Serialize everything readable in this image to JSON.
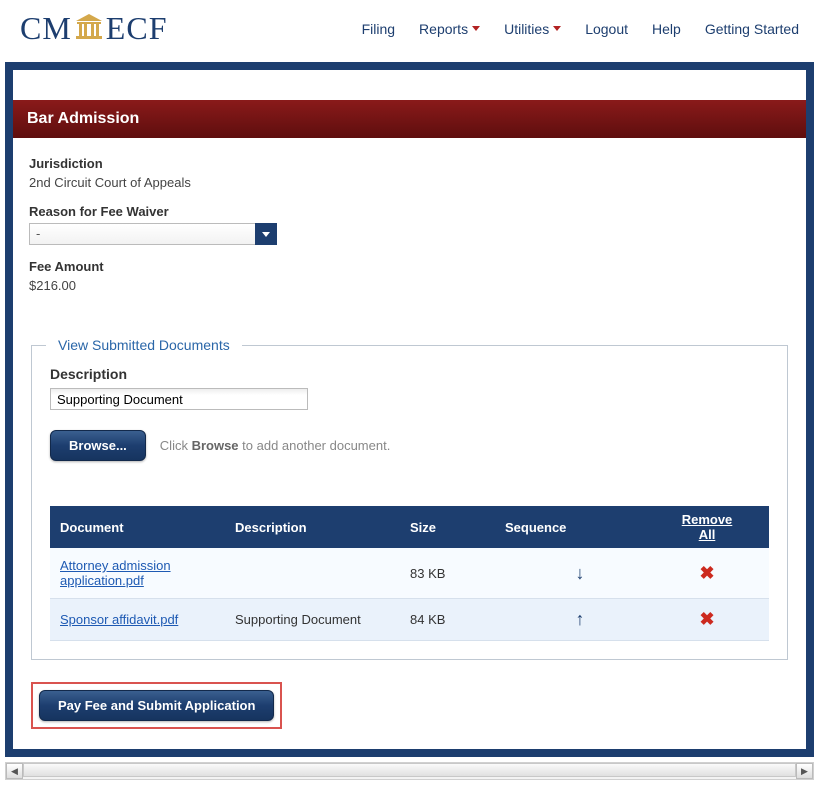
{
  "nav": {
    "logo_cm": "CM",
    "logo_ecf": "ECF",
    "items": [
      {
        "label": "Filing",
        "caret": false
      },
      {
        "label": "Reports",
        "caret": true
      },
      {
        "label": "Utilities",
        "caret": true
      },
      {
        "label": "Logout",
        "caret": false
      },
      {
        "label": "Help",
        "caret": false
      },
      {
        "label": "Getting Started",
        "caret": false
      }
    ]
  },
  "page": {
    "title": "Bar Admission",
    "jurisdiction_label": "Jurisdiction",
    "jurisdiction_value": "2nd Circuit Court of Appeals",
    "reason_label": "Reason for Fee Waiver",
    "reason_selected": "-",
    "fee_label": "Fee Amount",
    "fee_value": "$216.00"
  },
  "docs_section": {
    "legend": "View Submitted Documents",
    "desc_label": "Description",
    "desc_value": "Supporting Document",
    "browse_label": "Browse...",
    "hint_prefix": "Click ",
    "hint_bold": "Browse",
    "hint_suffix": " to add another document."
  },
  "table": {
    "headers": {
      "document": "Document",
      "description": "Description",
      "size": "Size",
      "sequence": "Sequence",
      "remove_all": "Remove All"
    },
    "rows": [
      {
        "doc": "Attorney admission application.pdf",
        "desc": "",
        "size": "83 KB",
        "arrow": "down"
      },
      {
        "doc": "Sponsor affidavit.pdf",
        "desc": "Supporting Document",
        "size": "84 KB",
        "arrow": "up"
      }
    ]
  },
  "submit": {
    "label": "Pay Fee and Submit Application"
  }
}
